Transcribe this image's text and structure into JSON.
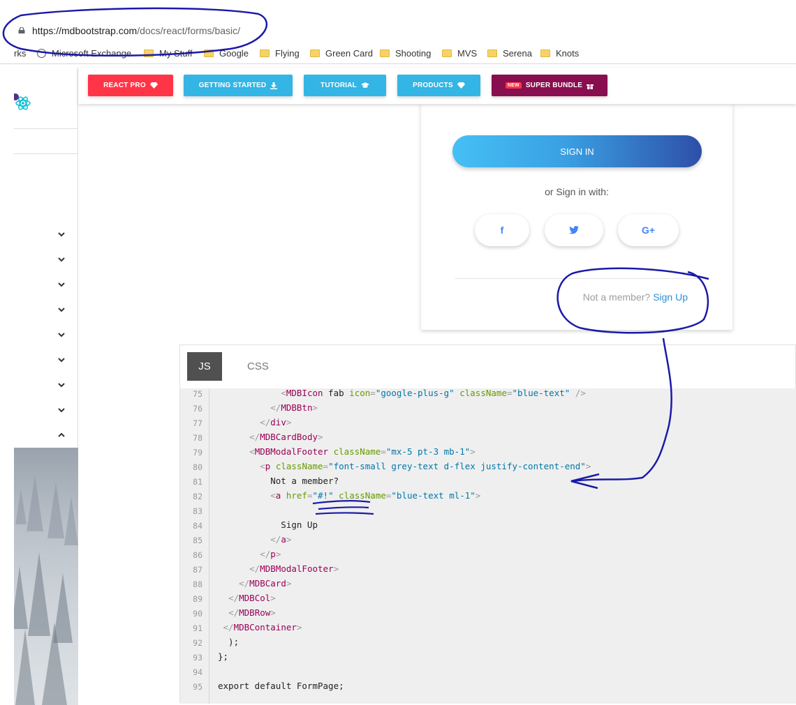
{
  "browser": {
    "url_host": "https://mdbootstrap.com",
    "url_path": "/docs/react/forms/basic/",
    "bookmarks": [
      {
        "label": "rks",
        "icon": "none"
      },
      {
        "label": "Microsoft Exchange",
        "icon": "globe-icon"
      },
      {
        "label": "My Stuff",
        "icon": "folder-icon"
      },
      {
        "label": "Google",
        "icon": "folder-icon"
      },
      {
        "label": "Flying",
        "icon": "folder-icon"
      },
      {
        "label": "Green Card",
        "icon": "folder-icon"
      },
      {
        "label": "Shooting",
        "icon": "folder-icon"
      },
      {
        "label": "MVS",
        "icon": "folder-icon"
      },
      {
        "label": "Serena",
        "icon": "folder-icon"
      },
      {
        "label": "Knots",
        "icon": "folder-icon"
      }
    ]
  },
  "nav": {
    "buttons": [
      {
        "label": "REACT PRO",
        "icon": "diamond-icon",
        "color": "#ff3547"
      },
      {
        "label": "GETTING STARTED",
        "icon": "download-icon",
        "color": "#33b5e5"
      },
      {
        "label": "TUTORIAL",
        "icon": "graduation-cap-icon",
        "color": "#33b5e5"
      },
      {
        "label": "PRODUCTS",
        "icon": "diamond-icon",
        "color": "#33b5e5"
      },
      {
        "label": "SUPER BUNDLE",
        "badge": "NEW",
        "icon": "gift-icon",
        "color": "#880e4f"
      }
    ]
  },
  "card": {
    "signin_label": "SIGN IN",
    "or_text": "or Sign in with:",
    "social": [
      {
        "glyph": "f",
        "icon": "facebook-icon"
      },
      {
        "glyph": "twitter",
        "icon": "twitter-icon"
      },
      {
        "glyph": "G+",
        "icon": "google-plus-icon"
      }
    ],
    "footer_text": "Not a member?",
    "footer_link": "Sign Up"
  },
  "code": {
    "tabs": [
      "JS",
      "CSS"
    ],
    "lines": [
      {
        "n": "75",
        "text": "            <MDBIcon fab icon=\"google-plus-g\" className=\"blue-text\" />"
      },
      {
        "n": "76",
        "text": "          </MDBBtn>"
      },
      {
        "n": "77",
        "text": "        </div>"
      },
      {
        "n": "78",
        "text": "      </MDBCardBody>"
      },
      {
        "n": "79",
        "text": "      <MDBModalFooter className=\"mx-5 pt-3 mb-1\">"
      },
      {
        "n": "80",
        "text": "        <p className=\"font-small grey-text d-flex justify-content-end\">"
      },
      {
        "n": "81",
        "text": "          Not a member?"
      },
      {
        "n": "82",
        "text": "          <a href=\"#!\" className=\"blue-text ml-1\">"
      },
      {
        "n": "83",
        "text": ""
      },
      {
        "n": "84",
        "text": "            Sign Up"
      },
      {
        "n": "85",
        "text": "          </a>"
      },
      {
        "n": "86",
        "text": "        </p>"
      },
      {
        "n": "87",
        "text": "      </MDBModalFooter>"
      },
      {
        "n": "88",
        "text": "    </MDBCard>"
      },
      {
        "n": "89",
        "text": "  </MDBCol>"
      },
      {
        "n": "90",
        "text": "  </MDBRow>"
      },
      {
        "n": "91",
        "text": " </MDBContainer>"
      },
      {
        "n": "92",
        "text": "  );"
      },
      {
        "n": "93",
        "text": "};"
      },
      {
        "n": "94",
        "text": ""
      },
      {
        "n": "95",
        "text": "export default FormPage;"
      }
    ]
  }
}
